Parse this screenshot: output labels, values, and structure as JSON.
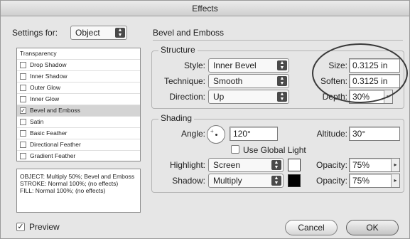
{
  "window": {
    "title": "Effects"
  },
  "settings": {
    "label": "Settings for:",
    "value": "Object"
  },
  "effects_list": {
    "header": "Transparency",
    "items": [
      {
        "label": "Drop Shadow",
        "checked": false
      },
      {
        "label": "Inner Shadow",
        "checked": false
      },
      {
        "label": "Outer Glow",
        "checked": false
      },
      {
        "label": "Inner Glow",
        "checked": false
      },
      {
        "label": "Bevel and Emboss",
        "checked": true
      },
      {
        "label": "Satin",
        "checked": false
      },
      {
        "label": "Basic Feather",
        "checked": false
      },
      {
        "label": "Directional Feather",
        "checked": false
      },
      {
        "label": "Gradient Feather",
        "checked": false
      }
    ]
  },
  "summary": {
    "line1": "OBJECT: Multiply 50%; Bevel and Emboss",
    "line2": "STROKE: Normal 100%; (no effects)",
    "line3": "FILL: Normal 100%; (no effects)"
  },
  "panel": {
    "title": "Bevel and Emboss"
  },
  "structure": {
    "title": "Structure",
    "style_label": "Style:",
    "style_value": "Inner Bevel",
    "technique_label": "Technique:",
    "technique_value": "Smooth",
    "direction_label": "Direction:",
    "direction_value": "Up",
    "size_label": "Size:",
    "size_value": "0.3125 in",
    "soften_label": "Soften:",
    "soften_value": "0.3125 in",
    "depth_label": "Depth:",
    "depth_value": "30%"
  },
  "shading": {
    "title": "Shading",
    "angle_label": "Angle:",
    "angle_value": "120°",
    "altitude_label": "Altitude:",
    "altitude_value": "30°",
    "global_light_label": "Use Global Light",
    "global_light_checked": false,
    "highlight_label": "Highlight:",
    "highlight_value": "Screen",
    "highlight_color": "#ffffff",
    "highlight_opacity_label": "Opacity:",
    "highlight_opacity_value": "75%",
    "shadow_label": "Shadow:",
    "shadow_value": "Multiply",
    "shadow_color": "#000000",
    "shadow_opacity_label": "Opacity:",
    "shadow_opacity_value": "75%"
  },
  "footer": {
    "preview_label": "Preview",
    "preview_checked": true,
    "cancel_label": "Cancel",
    "ok_label": "OK"
  }
}
